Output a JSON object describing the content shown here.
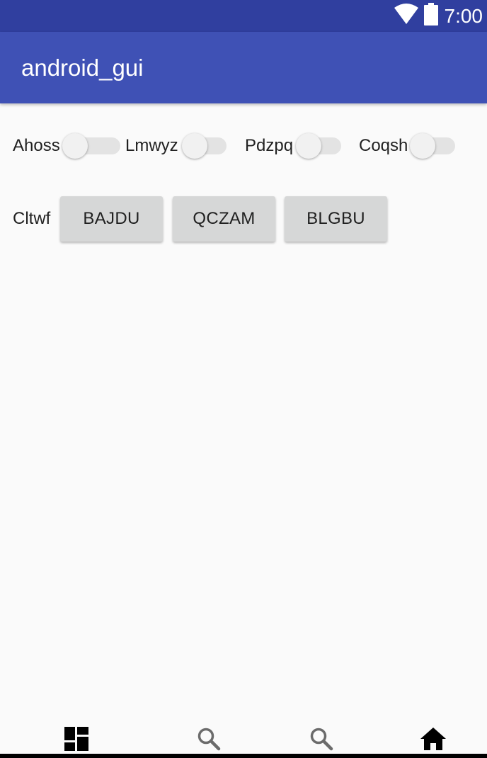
{
  "status_bar": {
    "time": "7:00",
    "icons": [
      "wifi-icon",
      "battery-icon"
    ],
    "color": "#303f9f"
  },
  "app_bar": {
    "title": "android_gui",
    "color": "#3f51b5"
  },
  "switches": [
    {
      "label": "Ahoss",
      "checked": false
    },
    {
      "label": "Lmwyz",
      "checked": false
    },
    {
      "label": "Pdzpq",
      "checked": false
    },
    {
      "label": "Coqsh",
      "checked": false
    }
  ],
  "button_row": {
    "label": "Cltwf",
    "buttons": [
      "BAJDU",
      "QCZAM",
      "BLGBU"
    ]
  },
  "bottom_nav": {
    "items": [
      {
        "icon": "dashboard-icon"
      },
      {
        "icon": "search-icon"
      },
      {
        "icon": "search-icon"
      },
      {
        "icon": "home-icon",
        "active": true
      }
    ]
  }
}
